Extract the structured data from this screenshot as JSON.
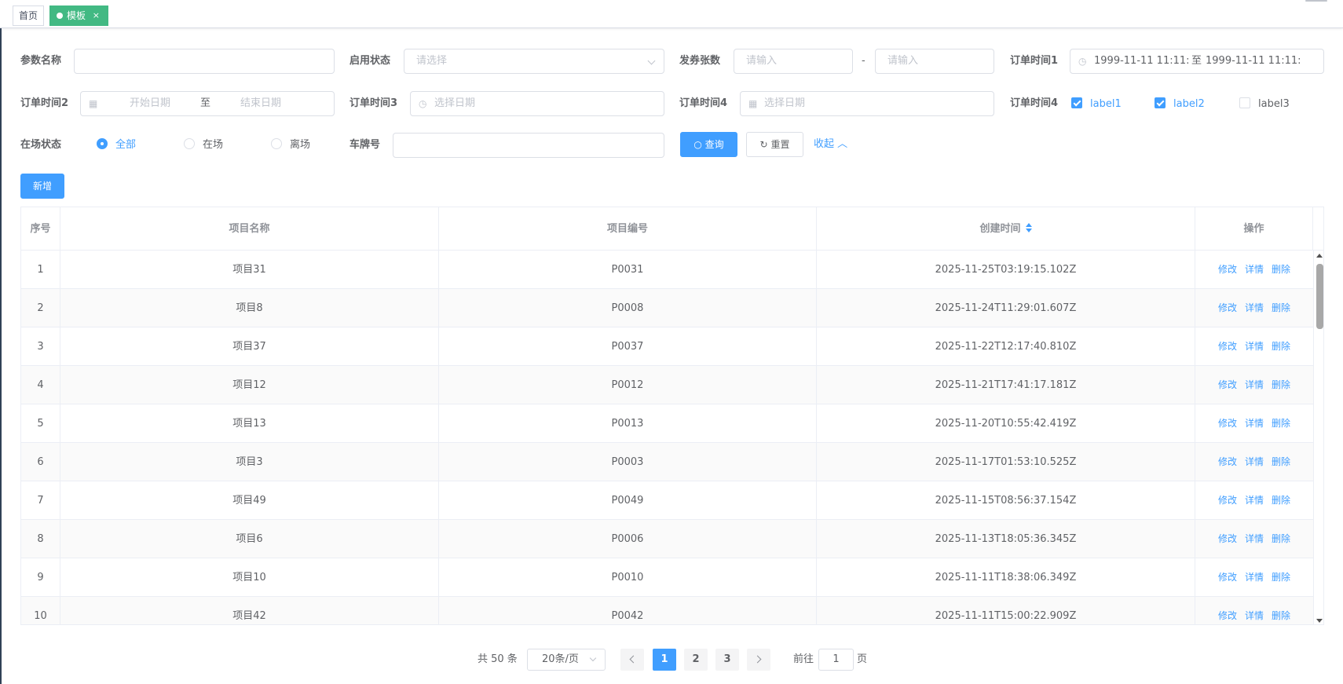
{
  "tabs": {
    "home": "首页",
    "active": "模板",
    "close": "×"
  },
  "search": {
    "param_name_label": "参数名称",
    "status_label": "启用状态",
    "status_placeholder": "请选择",
    "count_label": "发券张数",
    "count_min_placeholder": "请输入",
    "count_sep": "-",
    "count_max_placeholder": "请输入",
    "order_time1_label": "订单时间1",
    "order_time1_start": "1999-11-11 11:11:",
    "order_time1_sep": "至",
    "order_time1_end": "1999-11-11 11:11:",
    "order_time2_label": "订单时间2",
    "order_time2_start": "开始日期",
    "order_time2_sep": "至",
    "order_time2_end": "结束日期",
    "order_time3_label": "订单时间3",
    "order_time3_placeholder": "选择日期",
    "order_time4_label": "订单时间4",
    "date_placeholder": "选择日期",
    "order_time4_opts_label": "订单时间4",
    "checkboxes": [
      {
        "label": "label1",
        "checked": true
      },
      {
        "label": "label2",
        "checked": true
      },
      {
        "label": "label3",
        "checked": false
      }
    ],
    "presence_label": "在场状态",
    "radios": [
      {
        "label": "全部",
        "selected": true
      },
      {
        "label": "在场",
        "selected": false
      },
      {
        "label": "离场",
        "selected": false
      }
    ],
    "plate_label": "车牌号",
    "query_button": "查询",
    "reset_button": "重置",
    "collapse_link": "收起"
  },
  "toolbar": {
    "add_button": "新增"
  },
  "table": {
    "columns": [
      "序号",
      "项目名称",
      "项目编号",
      "创建时间",
      "操作"
    ],
    "actions": [
      "修改",
      "详情",
      "删除"
    ],
    "rows": [
      {
        "idx": "1",
        "name": "项目31",
        "code": "P0031",
        "created": "2025-11-25T03:19:15.102Z"
      },
      {
        "idx": "2",
        "name": "项目8",
        "code": "P0008",
        "created": "2025-11-24T11:29:01.607Z"
      },
      {
        "idx": "3",
        "name": "项目37",
        "code": "P0037",
        "created": "2025-11-22T12:17:40.810Z"
      },
      {
        "idx": "4",
        "name": "项目12",
        "code": "P0012",
        "created": "2025-11-21T17:41:17.181Z"
      },
      {
        "idx": "5",
        "name": "项目13",
        "code": "P0013",
        "created": "2025-11-20T10:55:42.419Z"
      },
      {
        "idx": "6",
        "name": "项目3",
        "code": "P0003",
        "created": "2025-11-17T01:53:10.525Z"
      },
      {
        "idx": "7",
        "name": "项目49",
        "code": "P0049",
        "created": "2025-11-15T08:56:37.154Z"
      },
      {
        "idx": "8",
        "name": "项目6",
        "code": "P0006",
        "created": "2025-11-13T18:05:36.345Z"
      },
      {
        "idx": "9",
        "name": "项目10",
        "code": "P0010",
        "created": "2025-11-11T18:38:06.349Z"
      },
      {
        "idx": "10",
        "name": "项目42",
        "code": "P0042",
        "created": "2025-11-11T15:00:22.909Z"
      }
    ]
  },
  "pagination": {
    "total": "共 50 条",
    "page_size": "20条/页",
    "pages": [
      "1",
      "2",
      "3"
    ],
    "current": "1",
    "goto_label": "前往",
    "goto_value": "1",
    "goto_suffix": "页"
  }
}
